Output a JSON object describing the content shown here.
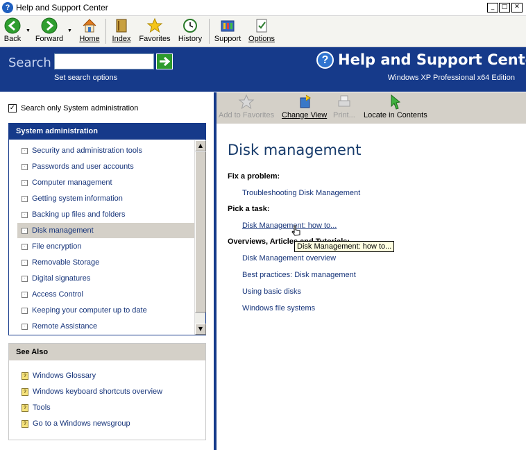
{
  "window": {
    "title": "Help and Support Center",
    "minimize_glyph": "_",
    "maximize_glyph": "□",
    "close_glyph": "✕"
  },
  "toolbar": {
    "back": "Back",
    "forward": "Forward",
    "home": "Home",
    "index": "Index",
    "favorites": "Favorites",
    "history": "History",
    "support": "Support",
    "options": "Options"
  },
  "header": {
    "search_label": "Search",
    "search_value": "",
    "search_options": "Set search options",
    "brand_title": "Help and Support Center",
    "edition": "Windows XP Professional x64 Edition"
  },
  "left": {
    "scope_checkbox_label": "Search only System administration",
    "scope_checked": true,
    "panel_title": "System administration",
    "topics": [
      "Security and administration tools",
      "Passwords and user accounts",
      "Computer management",
      "Getting system information",
      "Backing up files and folders",
      "Disk management",
      "File encryption",
      "Removable Storage",
      "Digital signatures",
      "Access Control",
      "Keeping your computer up to date",
      "Remote Assistance"
    ],
    "selected_topic": "Disk management",
    "see_also_title": "See Also",
    "see_also": [
      "Windows Glossary",
      "Windows keyboard shortcuts overview",
      "Tools",
      "Go to a Windows newsgroup"
    ]
  },
  "content_toolbar": {
    "add_to_favorites": "Add to Favorites",
    "change_view": "Change View",
    "print": "Print...",
    "locate_in_contents": "Locate in Contents"
  },
  "content": {
    "title": "Disk management",
    "fix_head": "Fix a problem:",
    "fix_links": [
      "Troubleshooting Disk Management"
    ],
    "task_head": "Pick a task:",
    "task_links": [
      "Disk Management: how to..."
    ],
    "overview_head": "Overviews, Articles and Tutorials:",
    "overview_links": [
      "Disk Management overview",
      "Best practices: Disk management",
      "Using basic disks",
      "Windows file systems"
    ],
    "tooltip": "Disk Management: how to..."
  },
  "colors": {
    "header_blue": "#163a8a",
    "link_blue": "#16347a",
    "selection_gray": "#d4d0c8"
  }
}
